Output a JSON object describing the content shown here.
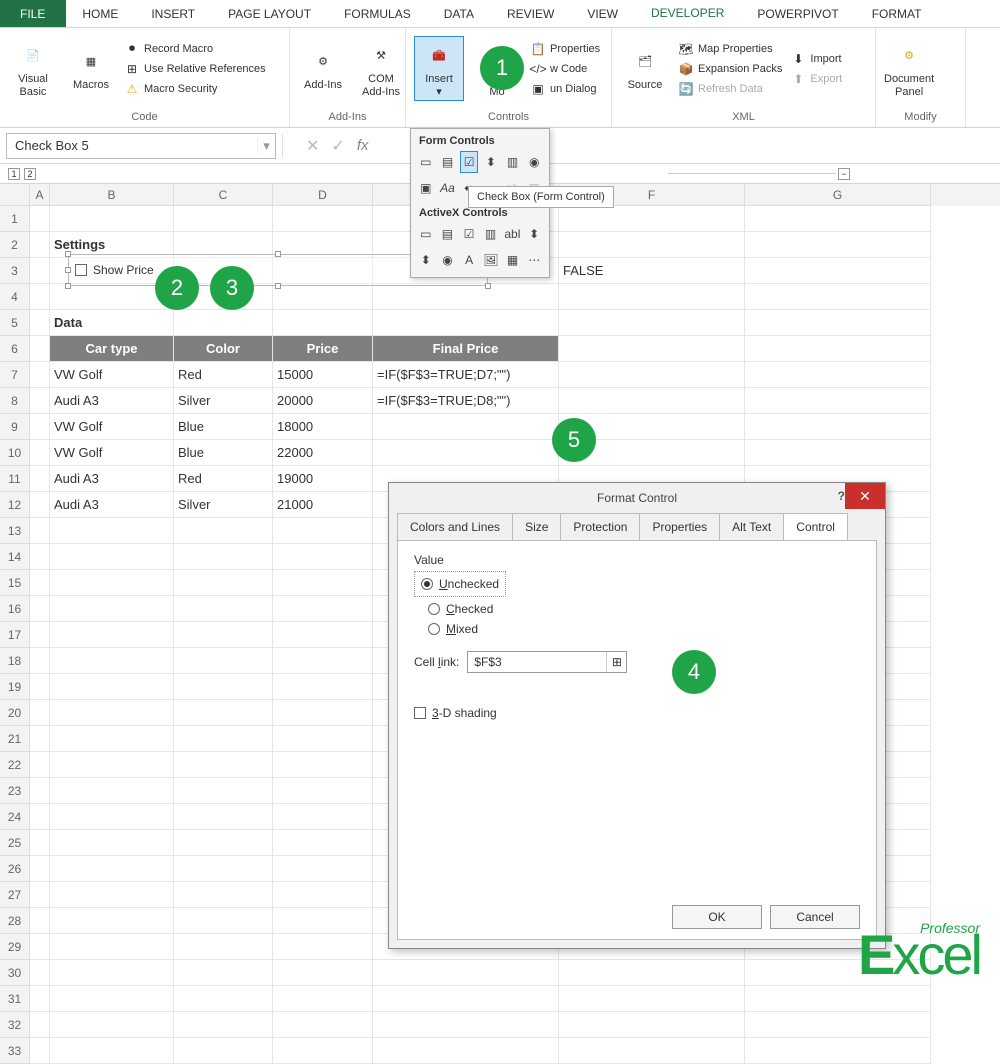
{
  "ribbon": {
    "tabs": [
      "FILE",
      "HOME",
      "INSERT",
      "PAGE LAYOUT",
      "FORMULAS",
      "DATA",
      "REVIEW",
      "VIEW",
      "DEVELOPER",
      "POWERPIVOT",
      "FORMAT"
    ],
    "active_tab": "DEVELOPER",
    "groups": {
      "code": {
        "label": "Code",
        "visual_basic": "Visual\nBasic",
        "macros": "Macros",
        "record": "Record Macro",
        "use_rel": "Use Relative References",
        "security": "Macro Security"
      },
      "addins": {
        "label": "Add-Ins",
        "addins": "Add-Ins",
        "com": "COM\nAdd-Ins"
      },
      "controls": {
        "label": "Controls",
        "insert": "Insert",
        "design": "Design\nMode",
        "props": "Properties",
        "view_code": "View Code",
        "run_dialog": "Run Dialog"
      },
      "xml": {
        "label": "XML",
        "source": "Source",
        "map_props": "Map Properties",
        "expansion": "Expansion Packs",
        "refresh": "Refresh Data",
        "import": "Import",
        "export": "Export"
      },
      "modify": {
        "label": "Modify",
        "doc_panel": "Document\nPanel"
      }
    }
  },
  "insert_panel": {
    "form_title": "Form Controls",
    "activex_title": "ActiveX Controls",
    "tooltip": "Check Box (Form Control)"
  },
  "formula": {
    "name_box": "Check Box 5"
  },
  "sheet": {
    "columns": [
      "A",
      "B",
      "C",
      "D",
      "E",
      "F",
      "G"
    ],
    "row_count": 33,
    "settings_label": "Settings",
    "checkbox_label": "Show Price",
    "f3_value": "FALSE",
    "data_label": "Data",
    "headers": {
      "car": "Car type",
      "color": "Color",
      "price": "Price",
      "final": "Final Price"
    },
    "rows": [
      {
        "car": "VW Golf",
        "color": "Red",
        "price": "15000",
        "formula": "=IF($F$3=TRUE;D7;\"\")"
      },
      {
        "car": "Audi A3",
        "color": "Silver",
        "price": "20000",
        "formula": "=IF($F$3=TRUE;D8;\"\")"
      },
      {
        "car": "VW Golf",
        "color": "Blue",
        "price": "18000",
        "formula": ""
      },
      {
        "car": "VW Golf",
        "color": "Blue",
        "price": "22000",
        "formula": ""
      },
      {
        "car": "Audi A3",
        "color": "Red",
        "price": "19000",
        "formula": ""
      },
      {
        "car": "Audi A3",
        "color": "Silver",
        "price": "21000",
        "formula": ""
      }
    ]
  },
  "dialog": {
    "title": "Format Control",
    "tabs": [
      "Colors and Lines",
      "Size",
      "Protection",
      "Properties",
      "Alt Text",
      "Control"
    ],
    "active_tab": "Control",
    "value_label": "Value",
    "opts": {
      "unchecked": "Unchecked",
      "checked": "Checked",
      "mixed": "Mixed"
    },
    "cell_link_label": "Cell link:",
    "cell_link_value": "$F$3",
    "shading": "3-D shading",
    "ok": "OK",
    "cancel": "Cancel"
  },
  "callouts": {
    "1": "1",
    "2": "2",
    "3": "3",
    "4": "4",
    "5": "5"
  },
  "logo": {
    "small": "Professor",
    "big": "Excel"
  }
}
